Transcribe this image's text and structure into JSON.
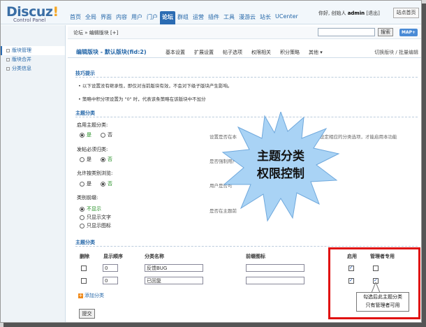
{
  "header": {
    "logo_main": "Discuz",
    "logo_bang": "!",
    "logo_sub": "Control Panel",
    "nav": [
      "首页",
      "全局",
      "界面",
      "内容",
      "用户",
      "门户",
      "论坛",
      "群组",
      "运营",
      "插件",
      "工具",
      "漫游云",
      "站长",
      "UCenter"
    ],
    "active_nav": "论坛",
    "user_greeting": "你好, 创始人",
    "username": "admin",
    "logout": "[退出]",
    "site_home": "站点首页"
  },
  "sidebar": {
    "items": [
      {
        "label": "版块管理"
      },
      {
        "label": "版块合并"
      },
      {
        "label": "分类信息"
      }
    ]
  },
  "crumb": {
    "text": "论坛 » 编辑版块",
    "add": "[+]",
    "search_button": "搜索",
    "map_button": "MAP"
  },
  "page": {
    "title": "编辑版块 - 默认版块(fid:2)",
    "tabs": [
      "基本设置",
      "扩展设置",
      "帖子选项",
      "权限相关",
      "积分策略",
      "其他"
    ],
    "tab_more_icon": "chevron-down-icon",
    "right_links": "切换版块 / 批量编辑"
  },
  "tips": {
    "heading": "技巧提示",
    "items": [
      "以下设置没有继承性，即仅对当前版块有效，不会对下级子版块产生影响。",
      "策略中积分项设置为 \"0\" 时，代表该条策略在该版块中不加分"
    ]
  },
  "topic_class": {
    "heading": "主题分类",
    "settings": [
      {
        "label": "启用主题分类:",
        "options": [
          "是",
          "否"
        ],
        "selected": 0,
        "desc": "设置是否在本",
        "desc_tail": "设定相应的分类选项，才能启用本功能"
      },
      {
        "label": "发帖必须归类:",
        "options": [
          "是",
          "否"
        ],
        "selected": 1,
        "desc": "是否强制用户"
      },
      {
        "label": "允许按类别浏览:",
        "options": [
          "是",
          "否"
        ],
        "selected": 1,
        "desc": "用户是否可"
      },
      {
        "label": "类别前缀:",
        "options": [
          "不显示",
          "只显示文字",
          "只显示图标"
        ],
        "selected": 0,
        "desc": "是否在主题前"
      }
    ]
  },
  "class_table": {
    "heading": "主题分类",
    "columns": [
      "删除",
      "显示顺序",
      "分类名称",
      "前缀图标",
      "启用",
      "管理者专用"
    ],
    "rows": [
      {
        "order": "0",
        "name": "反馈BUG",
        "enabled": true,
        "moderator_only": false
      },
      {
        "order": "0",
        "name": "已回复",
        "enabled": true,
        "moderator_only": true
      }
    ],
    "add_label": "添加分类",
    "submit": "提交"
  },
  "annotations": {
    "starburst_line1": "主题分类",
    "starburst_line2": "权限控制",
    "callout_line1": "勾选后此主题分类",
    "callout_line2": "只有管理者可用",
    "starburst_color": "#a9d3f5",
    "highlight_color": "#e01010"
  }
}
